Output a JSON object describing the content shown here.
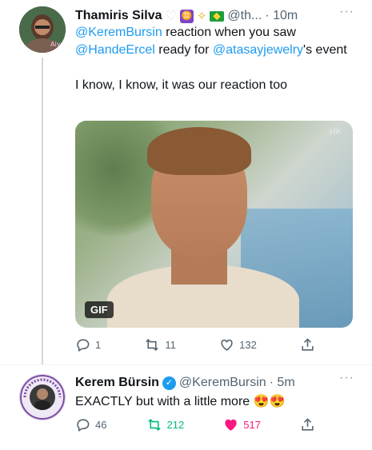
{
  "tweets": [
    {
      "author": {
        "name": "Thamiris Silva",
        "handle": "@th...",
        "time": "· 10m",
        "name_emojis": [
          "white-heart",
          "gemini-badge",
          "dizzy",
          "brazil-flag"
        ],
        "gemini_glyph": "♊"
      },
      "text": {
        "mention1": "@KeremBursin",
        "part1": " reaction when you saw ",
        "mention2": "@HandeErcel",
        "part2": " ready for ",
        "mention3": "@atasayjewelry",
        "part3": "'s event",
        "line2": "I know, I know, it was our reaction too"
      },
      "media": {
        "badge": "GIF",
        "watermark": "HK"
      },
      "actions": {
        "replies": "1",
        "retweets": "11",
        "likes": "132"
      }
    },
    {
      "author": {
        "name": "Kerem Bürsin",
        "handle": "@KeremBursin",
        "time": "· 5m",
        "verified": true
      },
      "text": {
        "body": "EXACTLY but with a little more 😍😍"
      },
      "actions": {
        "replies": "46",
        "retweets": "212",
        "likes": "517",
        "liked": true,
        "retweeted": true
      }
    }
  ],
  "more_glyph": "···",
  "colors": {
    "link": "#1d9bf0",
    "muted": "#536471",
    "like": "#f91880",
    "retweet": "#00ba7c"
  }
}
